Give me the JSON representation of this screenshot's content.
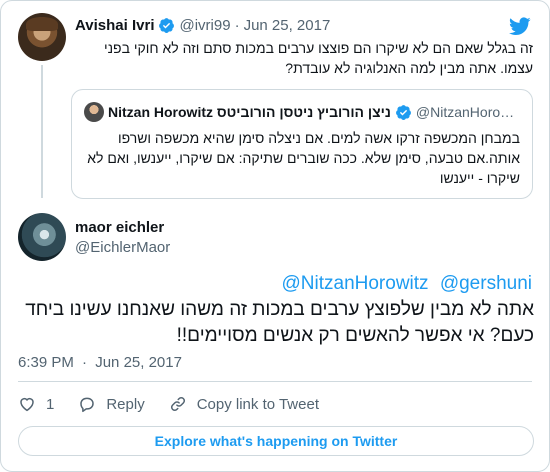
{
  "colors": {
    "accent": "#1d9bf0",
    "muted": "#536471",
    "border": "#cfd9de"
  },
  "parent": {
    "name": "Avishai Ivri",
    "handle": "@ivri99",
    "separator": "·",
    "date": "Jun 25, 2017",
    "text": "זה בגלל שאם הם לא שיקרו הם פוצצו ערבים במכות סתם וזה לא חוקי בפני עצמו. אתה מבין למה האנלוגיה לא עובדת?"
  },
  "quoted": {
    "name": "Nitzan Horowitz ניצן הורוביץ ניטסן הורוביטס",
    "handle": "@NitzanHoro…",
    "text": "במבחן המכשפה זרקו אשה למים. אם ניצלה סימן שהיא מכשפה ושרפו אותה.אם טבעה, סימן שלא. ככה שוברים שתיקה: אם שיקרו, ייענשו, ואם לא שיקרו - ייענשו"
  },
  "main": {
    "name": "maor eichler",
    "handle": "@EichlerMaor",
    "mentions": [
      "@NitzanHorowitz",
      "@gershuni"
    ],
    "text": "אתה לא מבין שלפוצץ ערבים במכות זה משהו שאנחנו עשינו ביחד כעם? אי אפשר להאשים רק אנשים מסויימים!!",
    "time": "6:39 PM",
    "separator": "·",
    "date": "Jun 25, 2017"
  },
  "actions": {
    "like_count": "1",
    "reply_label": "Reply",
    "copy_label": "Copy link to Tweet"
  },
  "explore_label": "Explore what's happening on Twitter",
  "icons": [
    "twitter-bird-icon",
    "verified-icon",
    "heart-icon",
    "reply-icon",
    "link-icon"
  ]
}
